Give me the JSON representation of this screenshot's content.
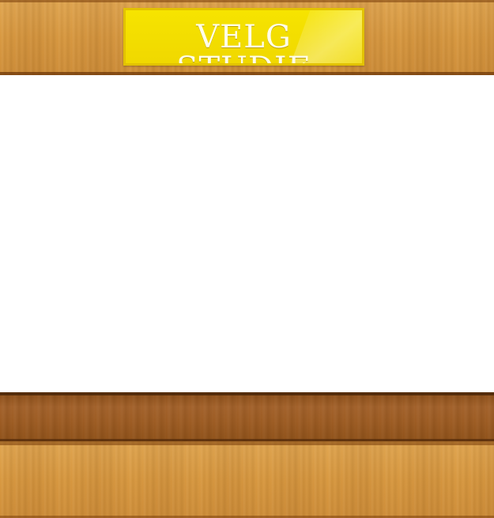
{
  "header": {
    "title": "VELG STUDIE"
  },
  "colors": {
    "wood_light": "#d99a3f",
    "wood_dark": "#9a5a1e",
    "sign_yellow": "#f6e400",
    "sign_text": "#fffde8",
    "content_background": "#ffffff"
  }
}
